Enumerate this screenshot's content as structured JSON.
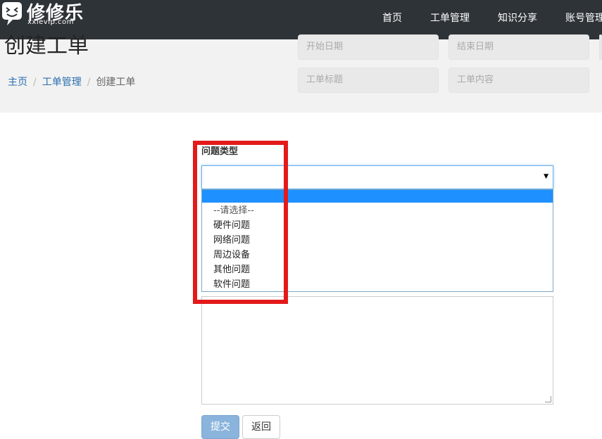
{
  "brand": {
    "name": "修修乐",
    "domain": "xxlevip.com"
  },
  "nav": {
    "items": [
      {
        "label": "首页"
      },
      {
        "label": "工单管理"
      },
      {
        "label": "知识分享"
      },
      {
        "label": "账号管理"
      }
    ]
  },
  "header": {
    "title": "创建工单",
    "breadcrumb": [
      "主页",
      "工单管理",
      "创建工单"
    ],
    "breadcrumb_sep": "/"
  },
  "filters": {
    "start_date_placeholder": "开始日期",
    "end_date_placeholder": "结束日期",
    "ticket_title_placeholder": "工单标题",
    "ticket_content_placeholder": "工单内容"
  },
  "form": {
    "issue_type_label": "问题类型",
    "issue_type_selected": "",
    "issue_type_options": [
      "--请选择--",
      "硬件问题",
      "网络问题",
      "周边设备",
      "其他问题",
      "软件问题"
    ],
    "submit_label": "提交",
    "back_label": "返回"
  },
  "colors": {
    "navbar": "#2e3338",
    "header_band": "#f2f2f2",
    "link": "#2a6fb0",
    "highlight": "#1e90ff",
    "annotation": "#e31a1a"
  }
}
